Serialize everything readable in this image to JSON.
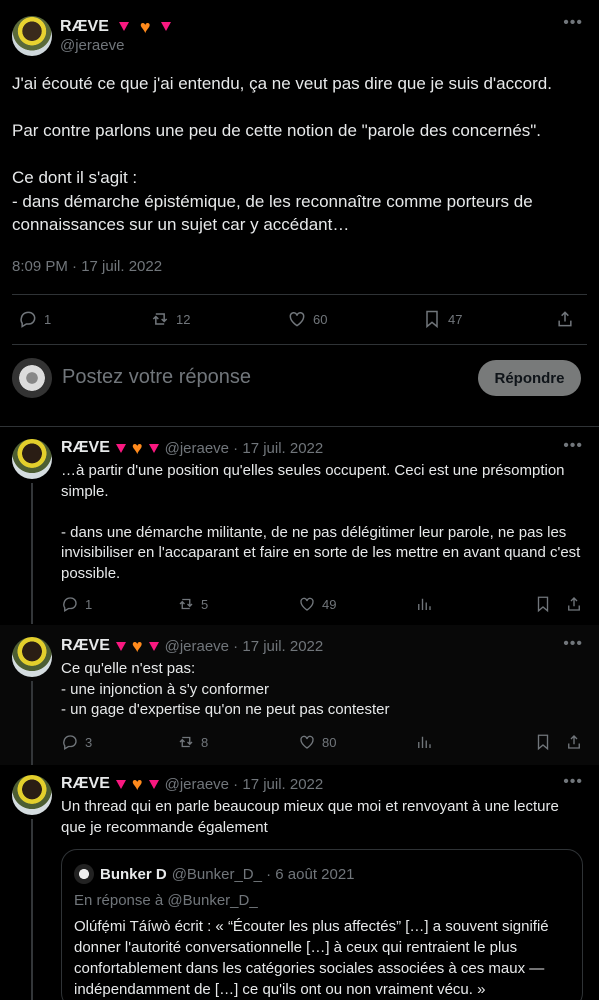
{
  "main_tweet": {
    "author_name": "RÆVE",
    "handle": "@jeraeve",
    "text": "J'ai écouté ce que j'ai entendu, ça ne veut pas dire que je suis d'accord.\n\nPar contre parlons une peu de cette notion de \"parole des concernés\".\n\nCe dont il s'agit :\n- dans démarche épistémique, de les reconnaître comme porteurs de connaissances sur un sujet car y accédant…",
    "timestamp": "8:09 PM · 17 juil. 2022",
    "replies": "1",
    "retweets": "12",
    "likes": "60",
    "bookmarks": "47"
  },
  "composer": {
    "placeholder": "Postez votre réponse",
    "reply_button": "Répondre"
  },
  "thread": [
    {
      "author_name": "RÆVE",
      "handle_time": "@jeraeve · 17 juil. 2022",
      "text": "…à partir d'une position qu'elles seules occupent. Ceci est une présomption simple.\n\n- dans une démarche militante, de ne pas délégitimer leur parole, ne pas les invisibiliser en l'accaparant et faire en sorte de les mettre en avant quand c'est possible.",
      "replies": "1",
      "retweets": "5",
      "likes": "49"
    },
    {
      "author_name": "RÆVE",
      "handle_time": "@jeraeve · 17 juil. 2022",
      "text": "Ce qu'elle n'est pas:\n- une injonction à s'y conformer\n- un gage d'expertise qu'on ne peut pas contester",
      "replies": "3",
      "retweets": "8",
      "likes": "80"
    },
    {
      "author_name": "RÆVE",
      "handle_time": "@jeraeve · 17 juil. 2022",
      "text": "Un thread qui en parle beaucoup mieux que moi et renvoyant à une lecture que je recommande également",
      "quote": {
        "author_name": "Bunker D",
        "handle_time": "@Bunker_D_ · 6 août 2021",
        "in_reply_to": "En réponse à @Bunker_D_",
        "text": "Olúfẹ́mi Táíwò écrit : « “Écouter les plus affectés” […] a souvent signifié donner l'autorité conversationnelle […] à ceux qui rentraient le plus confortablement dans les catégories sociales associées à ces maux — indépendamment de […] ce qu'ils ont ou non vraiment vécu. »"
      }
    }
  ],
  "icons": [
    "reply-icon",
    "retweet-icon",
    "like-icon",
    "bookmark-icon",
    "share-icon",
    "views-icon",
    "more-icon"
  ],
  "colors": {
    "background": "#000000",
    "text": "#e7e9ea",
    "muted": "#71767b",
    "border": "#2f3336",
    "badge_pink": "#f91880",
    "badge_orange": "#ff8a1c"
  }
}
